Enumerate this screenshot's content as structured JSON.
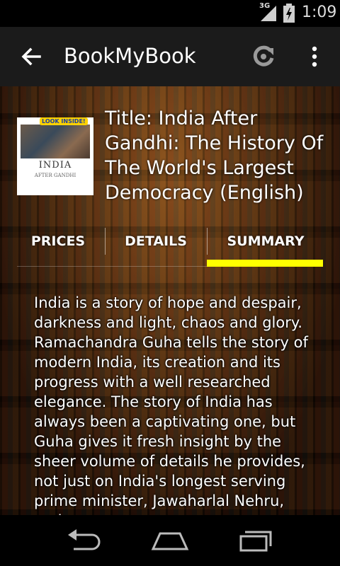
{
  "status_bar": {
    "network": "3G",
    "time": "1:09"
  },
  "action_bar": {
    "title": "BookMyBook",
    "back_icon": "arrow-back-icon",
    "refresh_icon": "refresh-icon",
    "overflow_icon": "overflow-menu-icon"
  },
  "book": {
    "cover_badge": "LOOK INSIDE!",
    "cover_title_line1": "INDIA",
    "cover_title_line2": "AFTER GANDHI",
    "title_line": "Title: India After Gandhi: The History Of The World's Largest Democracy (English)"
  },
  "tabs": [
    {
      "label": "PRICES",
      "selected": false
    },
    {
      "label": "DETAILS",
      "selected": false
    },
    {
      "label": "SUMMARY",
      "selected": true
    }
  ],
  "summary": {
    "text": "India is a story of hope and despair, darkness and light, chaos and glory. Ramachandra Guha tells the story of modern India, its creation and its progress with a well researched elegance. The story of India has always been a captivating one, but Guha gives it fresh insight by the sheer volume of details he provides, not just on India's longest serving prime minister, Jawaharlal Nehru, and"
  },
  "colors": {
    "indicator": "#ffff00",
    "action_bar": "#1b1b1b"
  },
  "nav_bar": {
    "icons": [
      "back-nav-icon",
      "home-nav-icon",
      "recents-nav-icon"
    ]
  }
}
